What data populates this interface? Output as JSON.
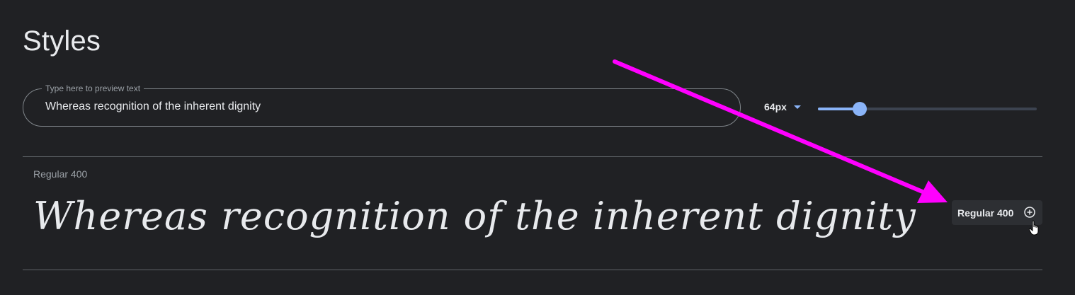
{
  "page": {
    "title": "Styles"
  },
  "preview": {
    "label": "Type here to preview text",
    "value": "Whereas recognition of the inherent dignity"
  },
  "size": {
    "selected": "64px",
    "slider_value": 0.19
  },
  "style_row": {
    "name": "Regular 400",
    "sample_text": "Whereas recognition of the inherent dignity",
    "button_label": "Regular 400",
    "button_icon": "plus-circle-icon"
  },
  "colors": {
    "background": "#202124",
    "accent": "#8ab4f8",
    "annotation": "#ff00ff"
  }
}
